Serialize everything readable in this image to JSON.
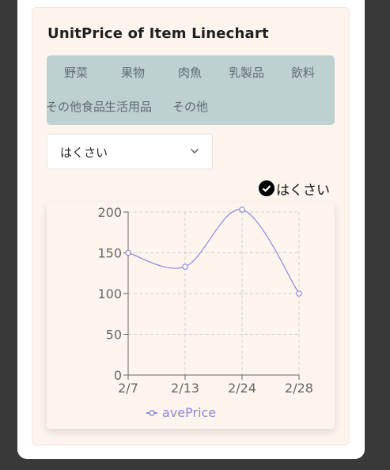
{
  "title": "UnitPrice of Item Linechart",
  "tabs": [
    "野菜",
    "果物",
    "肉魚",
    "乳製品",
    "飲料",
    "その他食品",
    "生活用品",
    "その他"
  ],
  "select": {
    "value": "はくさい"
  },
  "toggle": {
    "label": "はくさい"
  },
  "chart_data": {
    "type": "line",
    "categories": [
      "2/7",
      "2/13",
      "2/24",
      "2/28"
    ],
    "series": [
      {
        "name": "avePrice",
        "values": [
          150,
          133,
          203,
          100
        ],
        "color": "#8c88d8"
      }
    ],
    "yticks": [
      0,
      50,
      100,
      150,
      200
    ],
    "ylim": [
      0,
      200
    ],
    "grid": true,
    "legend": "bottom"
  }
}
